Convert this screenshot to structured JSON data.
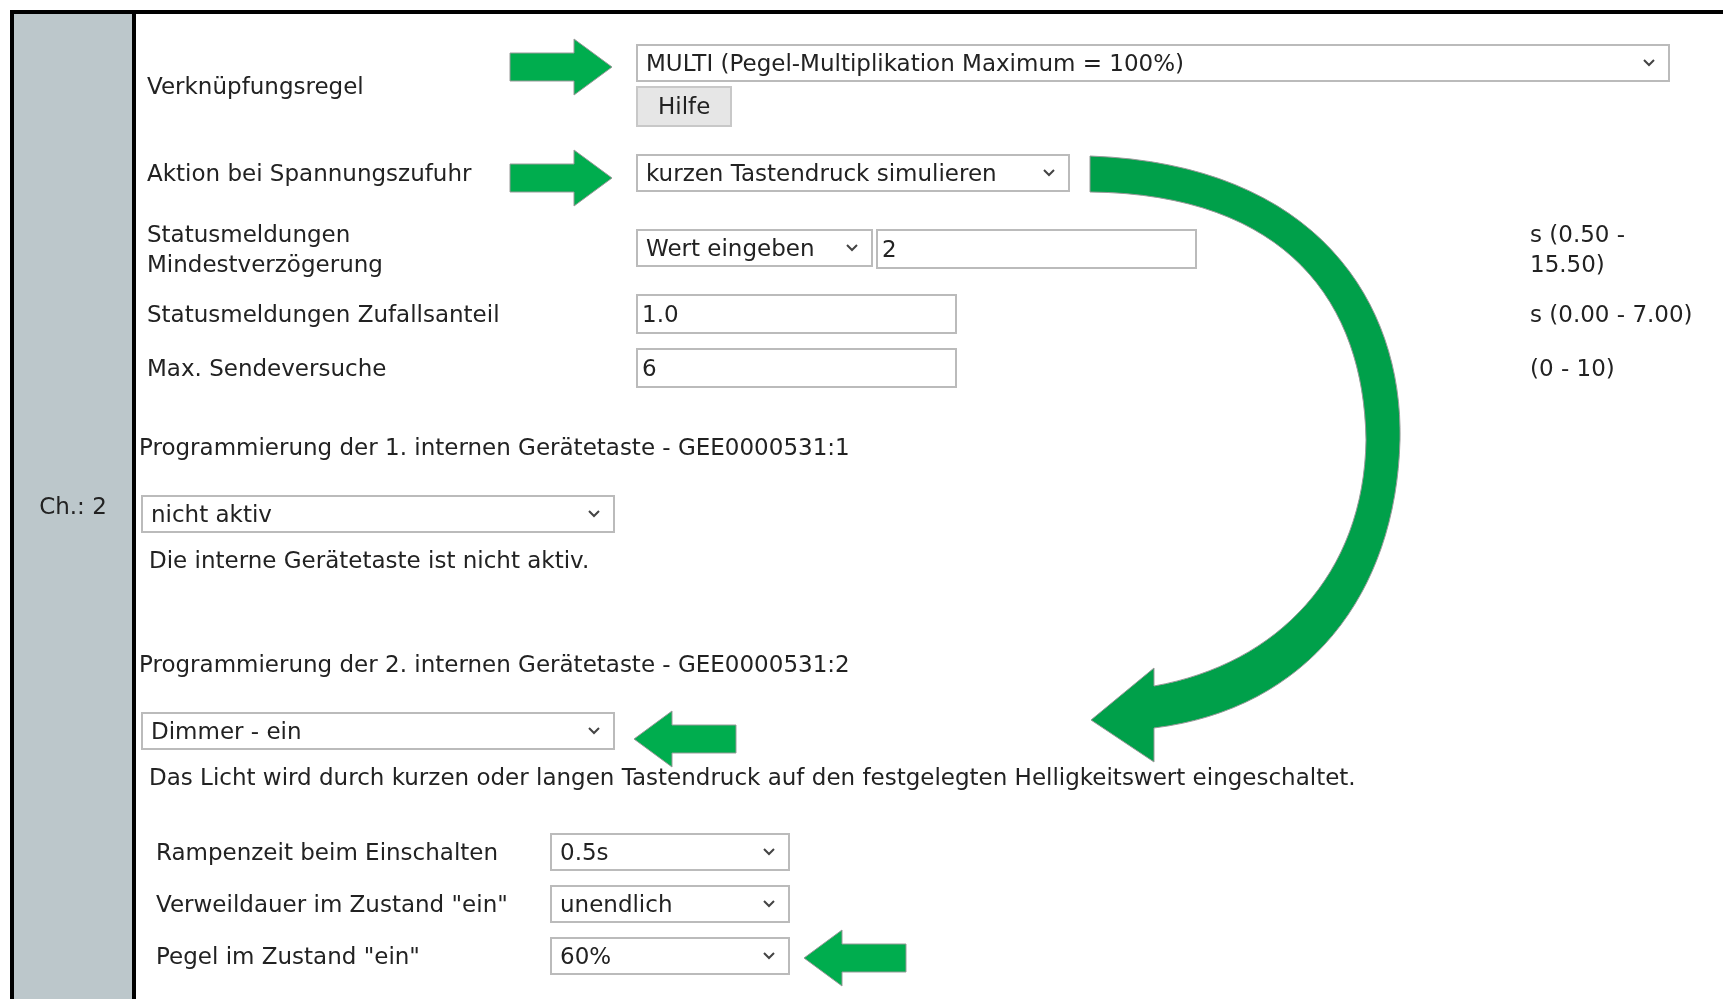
{
  "channel_label": "Ch.: 2",
  "settings": [
    {
      "label": "Verknüpfungsregel",
      "kind": "select_button",
      "value": "MULTI (Pegel-Multiplikation Maximum = 100%)",
      "button": "Hilfe"
    },
    {
      "label": "Aktion bei Spannungszufuhr",
      "kind": "select",
      "value": "kurzen Tastendruck simulieren"
    },
    {
      "label": "Statusmeldungen Mindestverzögerung",
      "kind": "select_input",
      "value": "Wert eingeben",
      "input": "2",
      "range": "s (0.50 - 15.50)"
    },
    {
      "label": "Statusmeldungen Zufallsanteil",
      "kind": "input",
      "input": "1.0",
      "range": "s (0.00 - 7.00)"
    },
    {
      "label": "Max. Sendeversuche",
      "kind": "input",
      "input": "6",
      "range": "(0 - 10)"
    }
  ],
  "buttons": [
    {
      "heading": "Programmierung der 1. internen Gerätetaste - GEE0000531:1",
      "value": "nicht aktiv",
      "description": "Die interne Gerätetaste ist nicht aktiv."
    },
    {
      "heading": "Programmierung der 2. internen Gerätetaste - GEE0000531:2",
      "value": "Dimmer - ein",
      "description": "Das Licht wird durch kurzen oder langen Tastendruck auf den festgelegten Helligkeitswert eingeschaltet.",
      "options": [
        {
          "label": "Rampenzeit beim Einschalten",
          "value": "0.5s"
        },
        {
          "label": "Verweildauer im Zustand \"ein\"",
          "value": "unendlich"
        },
        {
          "label": "Pegel im Zustand \"ein\"",
          "value": "60%"
        }
      ]
    }
  ]
}
